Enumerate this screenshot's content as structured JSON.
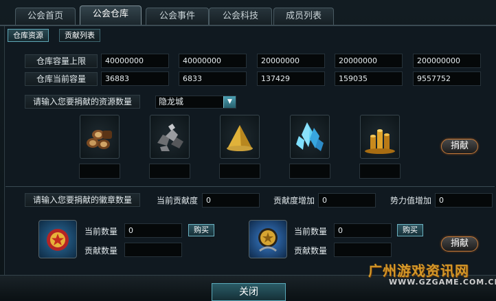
{
  "tabs": [
    {
      "label": "公会首页",
      "active": false
    },
    {
      "label": "公会仓库",
      "active": true
    },
    {
      "label": "公会事件",
      "active": false
    },
    {
      "label": "公会科技",
      "active": false
    },
    {
      "label": "成员列表",
      "active": false
    }
  ],
  "subtabs": {
    "resources": "仓库资源",
    "donation_list": "贡献列表"
  },
  "warehouse": {
    "capacity_label": "仓库容量上限",
    "current_label": "仓库当前容量",
    "capacity": [
      "40000000",
      "40000000",
      "20000000",
      "20000000",
      "200000000"
    ],
    "current": [
      "36883",
      "6833",
      "137429",
      "159035",
      "9557752"
    ]
  },
  "resource_donation": {
    "prompt": "请输入您要捐献的资源数量",
    "city_selected": "隐龙城",
    "resources": [
      "wood-icon",
      "iron-ore-icon",
      "grain-icon",
      "crystal-icon",
      "gold-icon"
    ],
    "donate_label": "捐献"
  },
  "medal_donation": {
    "prompt": "请输入您要捐献的徽章数量",
    "current_contribution_label": "当前贡献度",
    "current_contribution": "0",
    "contribution_increase_label": "贡献度增加",
    "contribution_increase": "0",
    "power_increase_label": "势力值增加",
    "power_increase": "0",
    "medals": [
      {
        "icon": "red-star-medal-icon",
        "count_label": "当前数量",
        "count": "0",
        "buy_label": "购买",
        "donate_count_label": "贡献数量"
      },
      {
        "icon": "gold-orb-medal-icon",
        "count_label": "当前数量",
        "count": "0",
        "buy_label": "购买",
        "donate_count_label": "贡献数量"
      }
    ],
    "donate_label": "捐献"
  },
  "close_label": "关闭",
  "watermark": {
    "text": "广州游戏资讯网",
    "url": "WWW.GZGAME.COM.CN"
  }
}
